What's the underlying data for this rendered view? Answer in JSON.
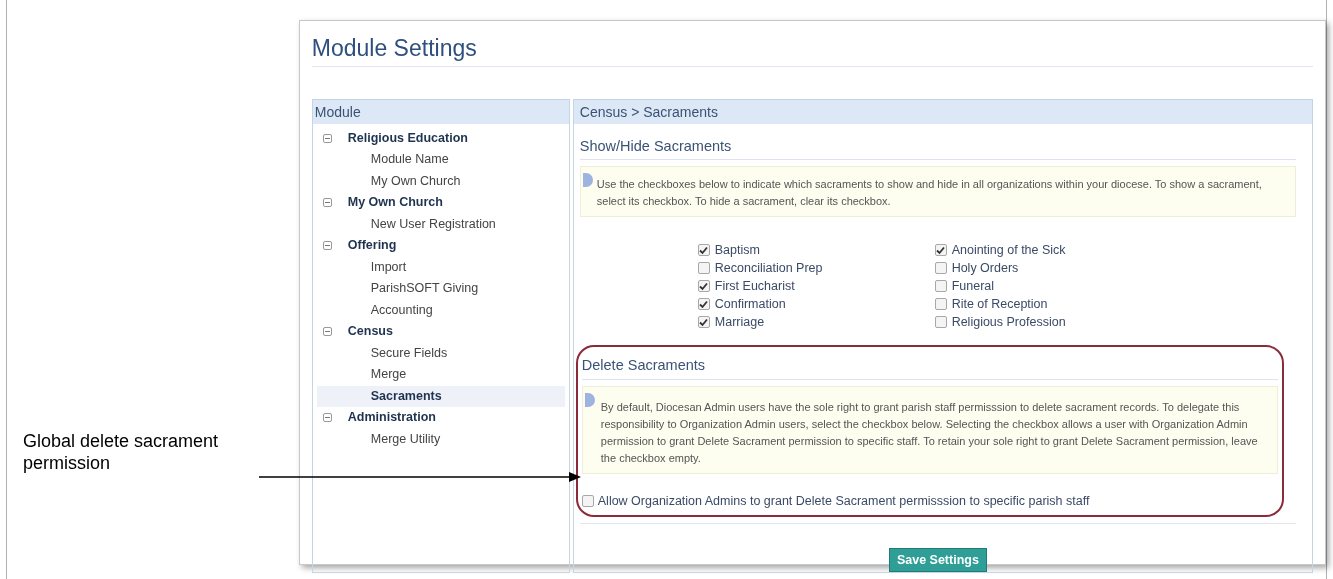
{
  "callout": {
    "text": "Global delete sacrament permission"
  },
  "page": {
    "title": "Module Settings"
  },
  "module_panel": {
    "header": "Module",
    "tree": [
      {
        "label": "Religious Education",
        "expanded": true,
        "children": [
          {
            "label": "Module Name",
            "selected": false
          },
          {
            "label": "My Own Church",
            "selected": false
          }
        ]
      },
      {
        "label": "My Own Church",
        "expanded": true,
        "children": [
          {
            "label": "New User Registration",
            "selected": false
          }
        ]
      },
      {
        "label": "Offering",
        "expanded": true,
        "children": [
          {
            "label": "Import",
            "selected": false
          },
          {
            "label": "ParishSOFT Giving",
            "selected": false
          },
          {
            "label": "Accounting",
            "selected": false
          }
        ]
      },
      {
        "label": "Census",
        "expanded": true,
        "children": [
          {
            "label": "Secure Fields",
            "selected": false
          },
          {
            "label": "Merge",
            "selected": false
          },
          {
            "label": "Sacraments",
            "selected": true
          }
        ]
      },
      {
        "label": "Administration",
        "expanded": true,
        "children": [
          {
            "label": "Merge Utility",
            "selected": false
          }
        ]
      }
    ]
  },
  "content": {
    "breadcrumb": "Census > Sacraments",
    "show_hide": {
      "heading": "Show/Hide Sacraments",
      "info": "Use the checkboxes below to indicate which sacraments to show and hide in all organizations within your diocese. To show a sacrament, select its checkbox. To hide a sacrament, clear its checkbox.",
      "sacraments": [
        {
          "label": "Baptism",
          "checked": true
        },
        {
          "label": "Reconciliation Prep",
          "checked": false
        },
        {
          "label": "First Eucharist",
          "checked": true
        },
        {
          "label": "Confirmation",
          "checked": true
        },
        {
          "label": "Marriage",
          "checked": true
        },
        {
          "label": "Anointing of the Sick",
          "checked": true
        },
        {
          "label": "Holy Orders",
          "checked": false
        },
        {
          "label": "Funeral",
          "checked": false
        },
        {
          "label": "Rite of Reception",
          "checked": false
        },
        {
          "label": "Religious Profession",
          "checked": false
        }
      ]
    },
    "delete": {
      "heading": "Delete Sacraments",
      "info": "By default, Diocesan Admin users have the sole right to grant parish staff permisssion to delete sacrament records. To delegate this responsibility to Organization Admin users, select the checkbox below. Selecting the checkbox allows a user with Organization Admin permission to grant Delete Sacrament permission to specific staff. To retain your sole right to grant Delete Sacrament permission, leave the checkbox empty.",
      "option": {
        "label": "Allow Organization Admins to grant Delete Sacrament permisssion to specific parish staff",
        "checked": false
      }
    },
    "save_button": "Save Settings"
  }
}
